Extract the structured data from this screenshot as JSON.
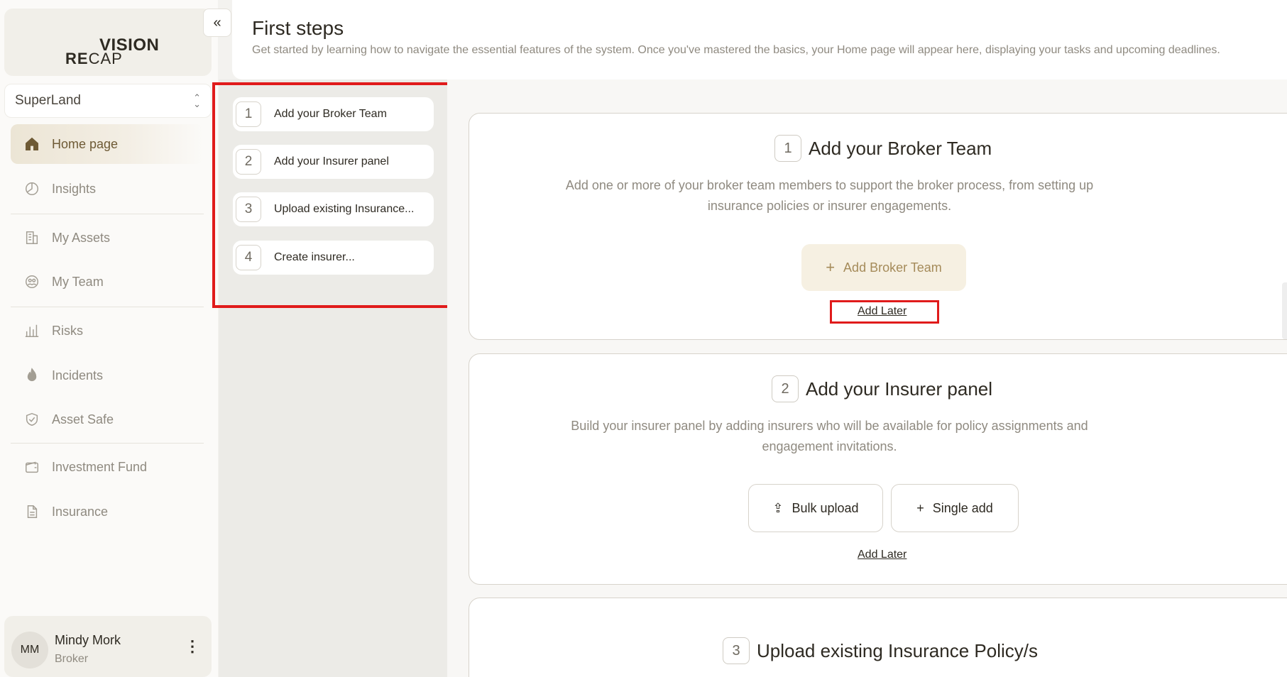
{
  "logo": {
    "line1": "VISION",
    "line2a": "RE",
    "line2b": "CAP"
  },
  "org_select": {
    "value": "SuperLand"
  },
  "nav": [
    {
      "label": "Home page",
      "icon": "home-icon"
    },
    {
      "label": "Insights",
      "icon": "pie-chart-icon"
    },
    {
      "label": "My Assets",
      "icon": "building-icon"
    },
    {
      "label": "My Team",
      "icon": "team-icon"
    },
    {
      "label": "Risks",
      "icon": "bar-chart-icon"
    },
    {
      "label": "Incidents",
      "icon": "flame-icon"
    },
    {
      "label": "Asset Safe",
      "icon": "shield-icon"
    },
    {
      "label": "Investment Fund",
      "icon": "wallet-icon"
    },
    {
      "label": "Insurance",
      "icon": "document-icon"
    }
  ],
  "user": {
    "initials": "MM",
    "name": "Mindy Mork",
    "role": "Broker"
  },
  "header": {
    "title": "First steps",
    "subtitle": "Get started by learning how to navigate the essential features of the system. Once you've mastered the basics, your Home page will appear here, displaying your tasks and upcoming deadlines."
  },
  "steps": [
    {
      "num": "1",
      "label": "Add your Broker Team"
    },
    {
      "num": "2",
      "label": "Add your Insurer panel"
    },
    {
      "num": "3",
      "label": "Upload existing Insurance..."
    },
    {
      "num": "4",
      "label": "Create insurer..."
    }
  ],
  "cards": {
    "broker": {
      "num": "1",
      "title": "Add your Broker Team",
      "desc_line1": "Add one or more of your broker team members to support the broker process, from setting up",
      "desc_line2": "insurance policies or insurer engagements.",
      "button": "Add Broker Team",
      "later": "Add Later"
    },
    "insurer": {
      "num": "2",
      "title": "Add your Insurer panel",
      "desc_line1": "Build your insurer panel by adding insurers who will be available for policy assignments and",
      "desc_line2": "engagement invitations.",
      "bulk": "Bulk upload",
      "single": "Single add",
      "later": "Add Later"
    },
    "policy": {
      "num": "3",
      "title": "Upload existing Insurance Policy/s"
    }
  },
  "colors": {
    "accent": "#a58b5a",
    "highlight": "#e01b1b",
    "active_nav": "#6e5a35"
  }
}
